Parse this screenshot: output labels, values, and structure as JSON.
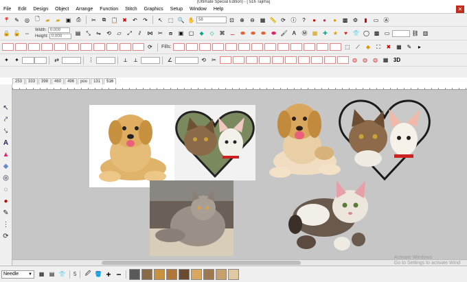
{
  "title": "(Ultimate Special Edition) - [ 516          Tajima]",
  "menu": [
    "File",
    "Edit",
    "Design",
    "Object",
    "Arrange",
    "Function",
    "Stitch",
    "Graphics",
    "Setup",
    "Window",
    "Help"
  ],
  "toolbar1": {
    "zoom_value": "58"
  },
  "toolbar2": {
    "width_label": "Width:",
    "height_label": "Height:",
    "width_value": "0.000",
    "height_value": "0.000"
  },
  "toolbar3": {
    "fills_label": "Fills:",
    "view_3d": "3D"
  },
  "design_tabs": [
    "253",
    "333",
    "398",
    "460",
    "496",
    "poo",
    "131",
    "516"
  ],
  "active_tab": "516",
  "bottom": {
    "needle_label": "Needle",
    "number": "5"
  },
  "watermark": {
    "line1": "Activate Windows",
    "line2": "Go to Settings to activate Wind"
  },
  "colors": {
    "canvas": "#c6c6c6",
    "accent_red": "#d23a2a",
    "thread_green": "#2e8b3a"
  }
}
